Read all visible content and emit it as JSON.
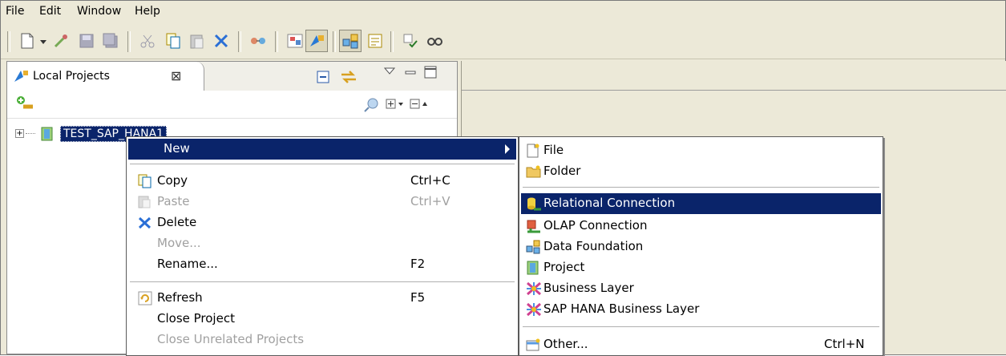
{
  "menubar": {
    "items": [
      "File",
      "Edit",
      "Window",
      "Help"
    ]
  },
  "toolbar": {
    "buttons": [
      "new-icon",
      "dropdown-icon",
      "wand-icon",
      "save-icon",
      "save-all-icon",
      "cut-icon",
      "copy-icon",
      "paste-icon",
      "delete-icon",
      "connection-icon",
      "perspective-icon",
      "projects-icon",
      "data-foundation-icon",
      "properties-icon",
      "check-icon",
      "find-icon"
    ]
  },
  "view": {
    "tab_label": "Local Projects",
    "tab_close": "⊠"
  },
  "tree": {
    "project_label": "TEST_SAP_HANA1",
    "expander": "+"
  },
  "context_menu": {
    "items": [
      {
        "label": "New",
        "accel": "",
        "state": "selected",
        "submenu": true
      },
      {
        "label": "Copy",
        "accel": "Ctrl+C",
        "state": "normal"
      },
      {
        "label": "Paste",
        "accel": "Ctrl+V",
        "state": "disabled"
      },
      {
        "label": "Delete",
        "accel": "",
        "state": "normal"
      },
      {
        "label": "Move...",
        "accel": "",
        "state": "disabled"
      },
      {
        "label": "Rename...",
        "accel": "F2",
        "state": "normal"
      },
      {
        "label": "Refresh",
        "accel": "F5",
        "state": "normal"
      },
      {
        "label": "Close Project",
        "accel": "",
        "state": "normal"
      },
      {
        "label": "Close Unrelated Projects",
        "accel": "",
        "state": "disabled"
      }
    ]
  },
  "new_submenu": {
    "items": [
      {
        "label": "File",
        "accel": "",
        "icon": "file-icon"
      },
      {
        "label": "Folder",
        "accel": "",
        "icon": "folder-icon"
      },
      {
        "label": "Relational Connection",
        "accel": "",
        "icon": "relational-connection-icon",
        "state": "selected"
      },
      {
        "label": "OLAP Connection",
        "accel": "",
        "icon": "olap-connection-icon"
      },
      {
        "label": "Data Foundation",
        "accel": "",
        "icon": "data-foundation-icon"
      },
      {
        "label": "Project",
        "accel": "",
        "icon": "project-icon"
      },
      {
        "label": "Business Layer",
        "accel": "",
        "icon": "business-layer-icon"
      },
      {
        "label": "SAP HANA Business Layer",
        "accel": "",
        "icon": "sap-hana-business-layer-icon"
      },
      {
        "label": "Other...",
        "accel": "Ctrl+N",
        "icon": "other-icon"
      }
    ]
  },
  "colors": {
    "selection": "#0a246a",
    "chrome": "#ece9d8"
  }
}
